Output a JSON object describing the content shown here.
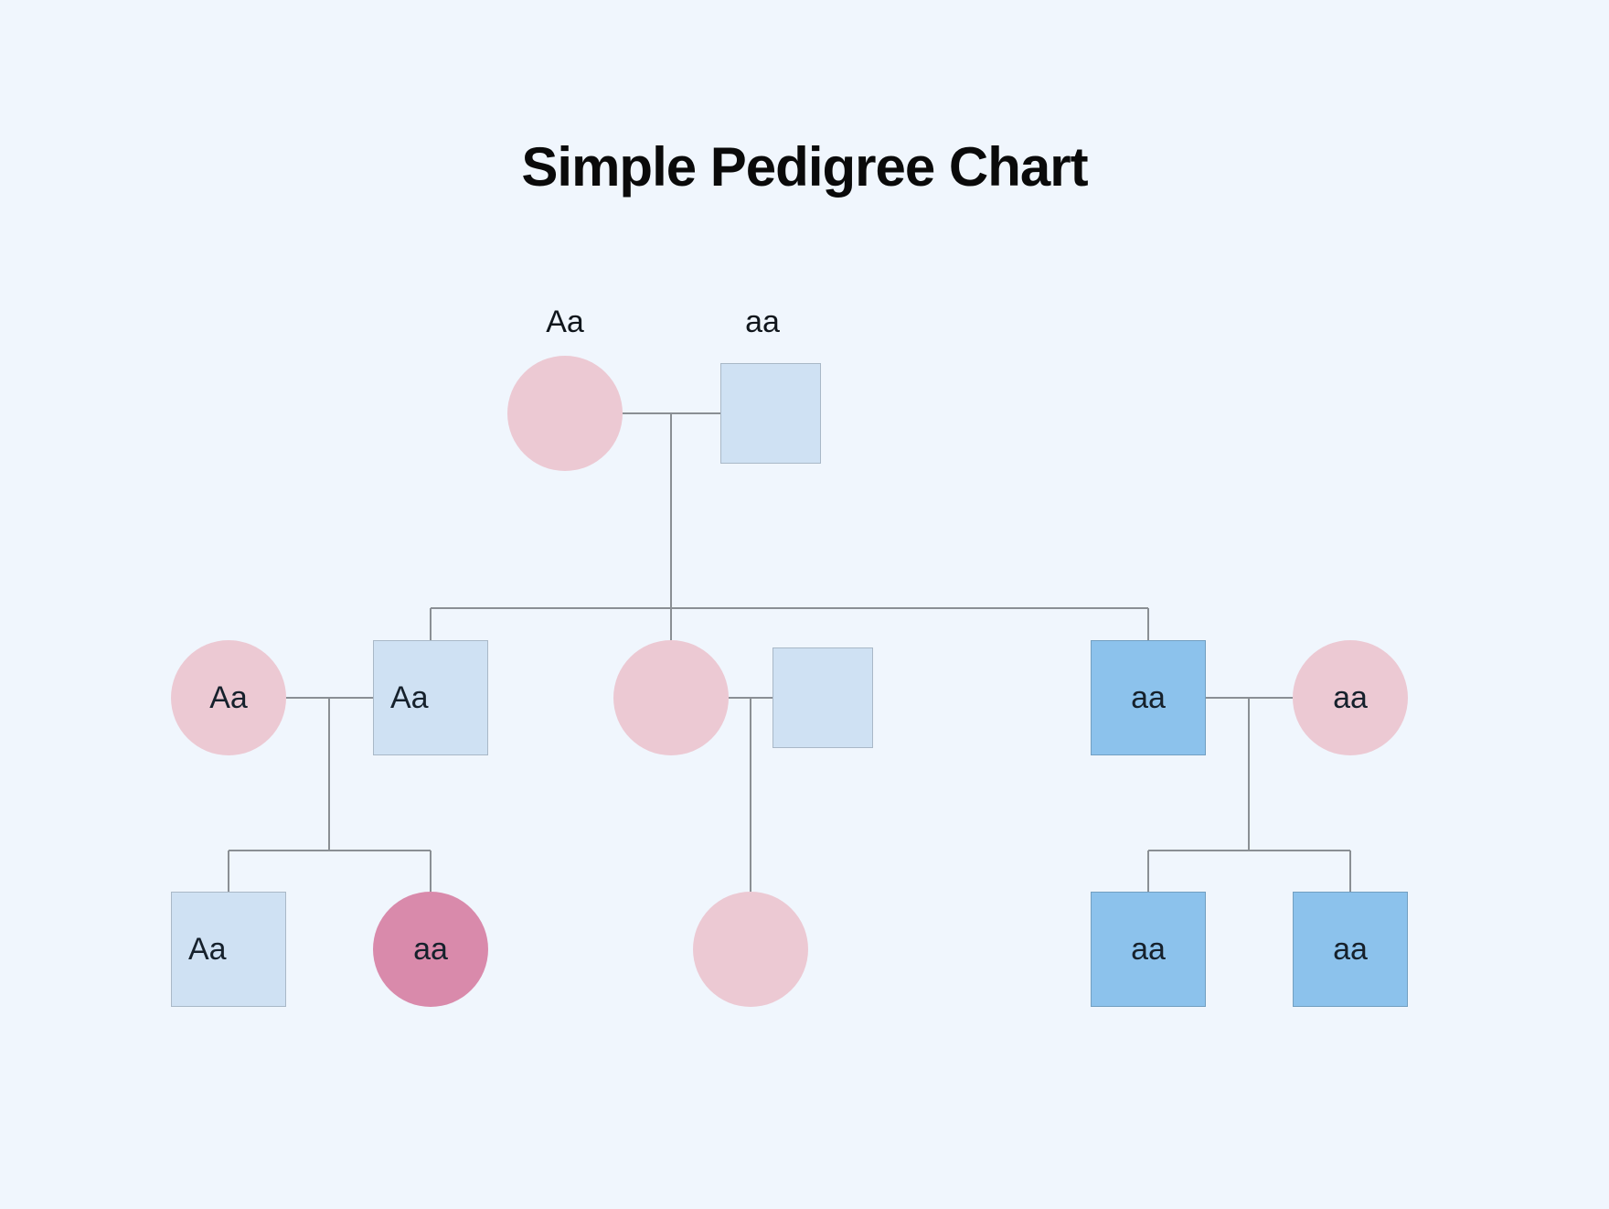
{
  "title": "Simple Pedigree Chart",
  "colors": {
    "background": "#f0f6fd",
    "pale_blue": "#cfe1f3",
    "med_blue": "#8cc2ec",
    "pale_pink": "#ecc9d3",
    "med_pink": "#d98aab",
    "line": "#8a8f94",
    "text": "#10161c"
  },
  "legend": {
    "square": "male",
    "circle": "female"
  },
  "nodes": {
    "g1_mother": {
      "sex": "F",
      "shade": "pale_pink",
      "genotype": "Aa",
      "genotype_placement": "above"
    },
    "g1_father": {
      "sex": "M",
      "shade": "pale_blue",
      "genotype": "aa",
      "genotype_placement": "above"
    },
    "g2_left_wife": {
      "sex": "F",
      "shade": "pale_pink",
      "genotype": "Aa",
      "genotype_placement": "inside"
    },
    "g2_left_husband": {
      "sex": "M",
      "shade": "pale_blue",
      "genotype": "Aa",
      "genotype_placement": "inside-left"
    },
    "g2_mid_wife": {
      "sex": "F",
      "shade": "pale_pink",
      "genotype": "",
      "genotype_placement": "none"
    },
    "g2_mid_husband": {
      "sex": "M",
      "shade": "pale_blue",
      "genotype": "",
      "genotype_placement": "none"
    },
    "g2_right_husband": {
      "sex": "M",
      "shade": "med_blue",
      "genotype": "aa",
      "genotype_placement": "inside"
    },
    "g2_right_wife": {
      "sex": "F",
      "shade": "pale_pink",
      "genotype": "aa",
      "genotype_placement": "inside"
    },
    "g3_left_son": {
      "sex": "M",
      "shade": "pale_blue",
      "genotype": "Aa",
      "genotype_placement": "inside-left"
    },
    "g3_left_daughter": {
      "sex": "F",
      "shade": "med_pink",
      "genotype": "aa",
      "genotype_placement": "inside"
    },
    "g3_mid_daughter": {
      "sex": "F",
      "shade": "pale_pink",
      "genotype": "",
      "genotype_placement": "none"
    },
    "g3_right_son1": {
      "sex": "M",
      "shade": "med_blue",
      "genotype": "aa",
      "genotype_placement": "inside"
    },
    "g3_right_son2": {
      "sex": "M",
      "shade": "med_blue",
      "genotype": "aa",
      "genotype_placement": "inside"
    }
  },
  "couples": [
    [
      "g1_mother",
      "g1_father"
    ],
    [
      "g2_left_wife",
      "g2_left_husband"
    ],
    [
      "g2_mid_wife",
      "g2_mid_husband"
    ],
    [
      "g2_right_husband",
      "g2_right_wife"
    ]
  ],
  "children": {
    "g1_mother+g1_father": [
      "g2_left_husband",
      "g2_mid_wife",
      "g2_right_husband"
    ],
    "g2_left_wife+g2_left_husband": [
      "g3_left_son",
      "g3_left_daughter"
    ],
    "g2_mid_wife+g2_mid_husband": [
      "g3_mid_daughter"
    ],
    "g2_right_husband+g2_right_wife": [
      "g3_right_son1",
      "g3_right_son2"
    ]
  }
}
